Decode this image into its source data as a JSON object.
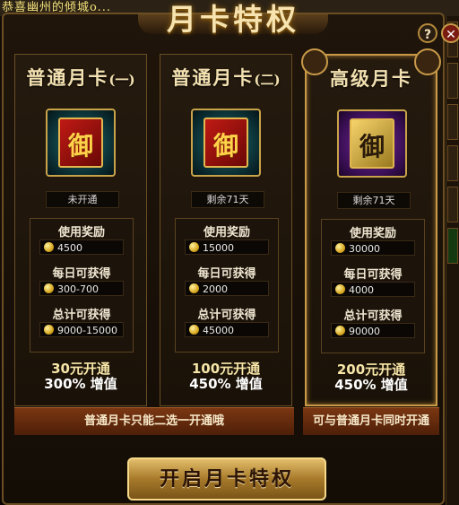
{
  "top_ticker": "恭喜幽州的倾城o...",
  "window": {
    "title": "月卡特权",
    "help": "?",
    "close": "✕"
  },
  "cards": [
    {
      "title": "普通月卡",
      "suffix": "(一)",
      "icon": "red-card-icon",
      "glyph": "御",
      "status": "未开通",
      "reward_label": "使用奖励",
      "reward": "4500",
      "daily_label": "每日可获得",
      "daily": "300-700",
      "total_label": "总计可获得",
      "total": "9000-15000",
      "price": "30元开通",
      "bonus": "300% 增值"
    },
    {
      "title": "普通月卡",
      "suffix": "(二)",
      "icon": "red-card-icon",
      "glyph": "御",
      "status": "剩余71天",
      "reward_label": "使用奖励",
      "reward": "15000",
      "daily_label": "每日可获得",
      "daily": "2000",
      "total_label": "总计可获得",
      "total": "45000",
      "price": "100元开通",
      "bonus": "450% 增值"
    },
    {
      "title": "高级月卡",
      "suffix": "",
      "icon": "gold-card-icon",
      "glyph": "御",
      "status": "剩余71天",
      "reward_label": "使用奖励",
      "reward": "30000",
      "daily_label": "每日可获得",
      "daily": "4000",
      "total_label": "总计可获得",
      "total": "90000",
      "price": "200元开通",
      "bonus": "450% 增值"
    }
  ],
  "notices": {
    "normal": "普通月卡只能二选一开通哦",
    "premium": "可与普通月卡同时开通"
  },
  "action_button": "开启月卡特权",
  "colors": {
    "gold": "#c89a48",
    "panel": "#1c140a",
    "notice": "#7a3612"
  }
}
